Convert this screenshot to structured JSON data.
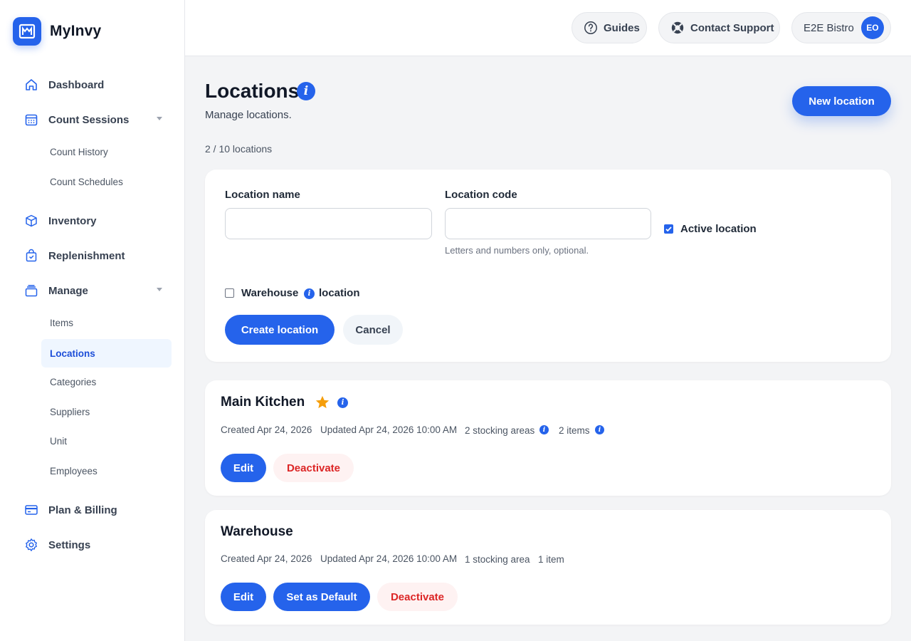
{
  "app": {
    "name": "MyInvy"
  },
  "sidebar": {
    "items": [
      {
        "label": "Dashboard"
      },
      {
        "label": "Count Sessions"
      },
      {
        "label": "Inventory"
      },
      {
        "label": "Replenishment"
      },
      {
        "label": "Manage"
      },
      {
        "label": "Plan & Billing"
      },
      {
        "label": "Settings"
      }
    ],
    "count_sessions_sub": [
      {
        "label": "Count History"
      },
      {
        "label": "Count Schedules"
      }
    ],
    "manage_sub": [
      {
        "label": "Items"
      },
      {
        "label": "Locations"
      },
      {
        "label": "Categories"
      },
      {
        "label": "Suppliers"
      },
      {
        "label": "Unit"
      },
      {
        "label": "Employees"
      }
    ]
  },
  "topbar": {
    "guides": "Guides",
    "support": "Contact Support",
    "workspace": "E2E Bistro",
    "avatar": "EO"
  },
  "page": {
    "title": "Locations",
    "subtitle": "Manage locations.",
    "count": "2 / 10 locations",
    "new_button": "New location"
  },
  "form": {
    "name_label": "Location name",
    "name_value": "",
    "code_label": "Location code",
    "code_value": "",
    "code_hint": "Letters and numbers only, optional.",
    "active_label": "Active location",
    "active_checked": true,
    "warehouse_label_a": "Warehouse",
    "warehouse_label_b": "location",
    "warehouse_checked": false,
    "create_button": "Create location",
    "cancel_button": "Cancel"
  },
  "locations": [
    {
      "name": "Main Kitchen",
      "is_default": true,
      "created": "Created Apr 24, 2026",
      "updated": "Updated Apr 24, 2026 10:00 AM",
      "areas": "2 stocking areas",
      "items": "2 items",
      "edit": "Edit",
      "deactivate": "Deactivate"
    },
    {
      "name": "Warehouse",
      "is_default": false,
      "created": "Created Apr 24, 2026",
      "updated": "Updated Apr 24, 2026 10:00 AM",
      "areas": "1 stocking area",
      "items": "1 item",
      "edit": "Edit",
      "set_default": "Set as Default",
      "deactivate": "Deactivate"
    }
  ],
  "colors": {
    "accent": "#2563eb",
    "danger": "#dc2626",
    "star": "#f59e0b"
  }
}
